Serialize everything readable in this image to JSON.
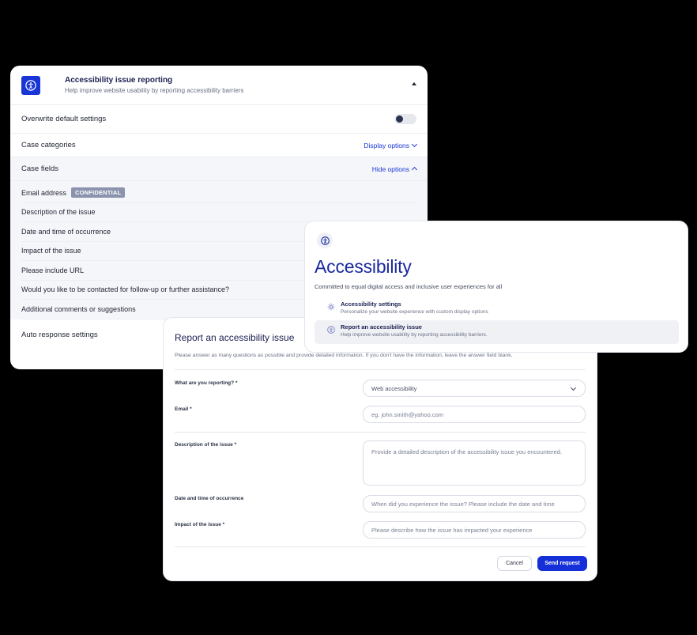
{
  "settings": {
    "title": "Accessibility issue reporting",
    "subtitle": "Help improve website usability by reporting accessibility barriers",
    "overwrite_label": "Overwrite default settings",
    "overwrite_enabled": false,
    "case_categories_label": "Case categories",
    "display_options_label": "Display options",
    "case_fields_label": "Case fields",
    "hide_options_label": "Hide options",
    "fields": [
      {
        "label": "Email address",
        "badge": "CONFIDENTIAL"
      },
      {
        "label": "Description of the issue"
      },
      {
        "label": "Date and time of occurrence"
      },
      {
        "label": "Impact of the issue"
      },
      {
        "label": "Please include URL"
      },
      {
        "label": "Would you like to be contacted for follow-up or further assistance?"
      },
      {
        "label": "Additional comments or suggestions"
      }
    ],
    "auto_response_label": "Auto response settings"
  },
  "accessibility": {
    "title": "Accessibility",
    "description": "Committed to equal digital access and inclusive user experiences for all",
    "items": [
      {
        "title": "Accessibility settings",
        "subtitle": "Personalize your website experience with custom display options",
        "icon": "gear-icon"
      },
      {
        "title": "Report an accessibility issue",
        "subtitle": "Help improve website usability by reporting accessibility barriers.",
        "icon": "accessibility-icon"
      }
    ]
  },
  "report": {
    "title": "Report an accessibility issue",
    "description": "Please answer as many questions as possible and provide detailed information. If you don't have the information, leave the answer field blank.",
    "what_label": "What are you reporting? *",
    "what_value": "Web accessibility",
    "email_label": "Email *",
    "email_placeholder": "eg. john.smith@yahoo.com",
    "description_label": "Description of the issue *",
    "description_placeholder": "Provide a detailed description of the accessibility issue you encountered.",
    "date_label": "Date and time of occurrence",
    "date_placeholder": "When did you experience the issue? Please include the date and time",
    "impact_label": "Impact of the issue *",
    "impact_placeholder": "Please describe how the issue has impacted your experience",
    "cancel_label": "Cancel",
    "send_label": "Send request"
  },
  "colors": {
    "accent": "#1a35d6",
    "title_blue": "#1a2a9e",
    "badge_gray": "#8b93ad"
  }
}
